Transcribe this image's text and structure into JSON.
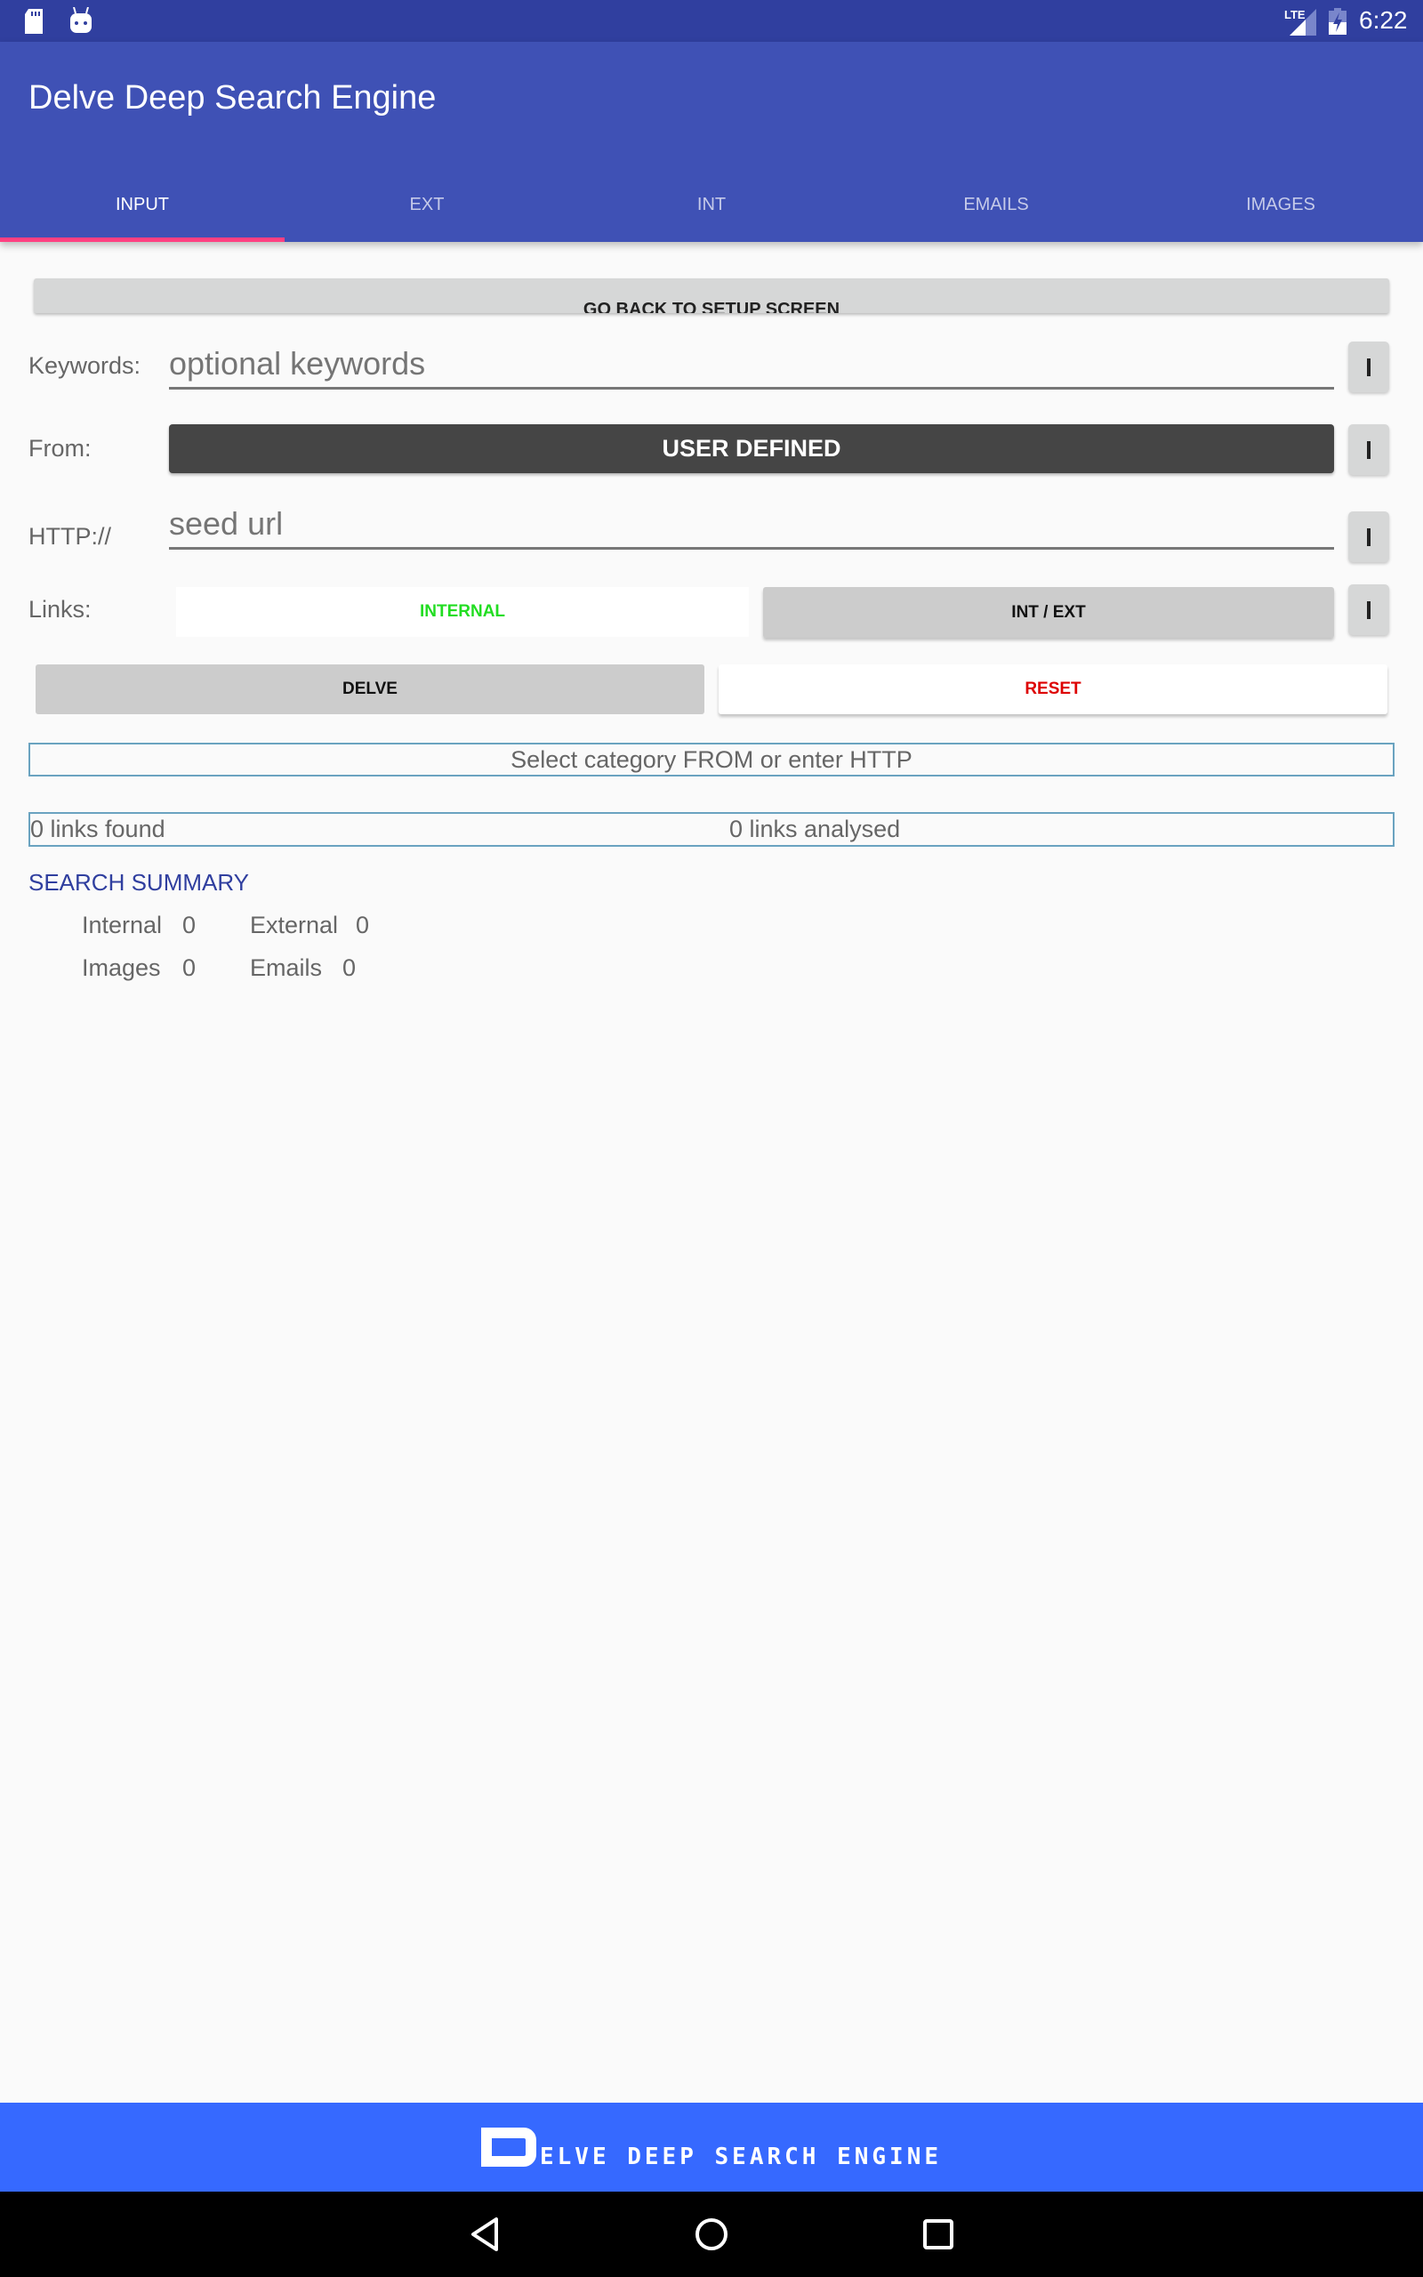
{
  "status_bar": {
    "left_icons": [
      "sd-card-icon",
      "android-debug-icon"
    ],
    "network": "LTE",
    "time": "6:22"
  },
  "app_bar": {
    "title": "Delve Deep Search Engine",
    "tabs": [
      {
        "label": "INPUT",
        "active": true
      },
      {
        "label": "EXT",
        "active": false
      },
      {
        "label": "INT",
        "active": false
      },
      {
        "label": "EMAILS",
        "active": false
      },
      {
        "label": "IMAGES",
        "active": false
      }
    ]
  },
  "form": {
    "go_back_label": "GO BACK TO SETUP SCREEN",
    "keywords": {
      "label": "Keywords:",
      "value": "",
      "placeholder": "optional keywords"
    },
    "from": {
      "label": "From:",
      "value": "USER DEFINED"
    },
    "http": {
      "label": "HTTP://",
      "value": "",
      "placeholder": "seed url"
    },
    "links": {
      "label": "Links:",
      "options": [
        "INTERNAL",
        "INT / EXT"
      ]
    },
    "info_button_label": "I",
    "delve_label": "DELVE",
    "reset_label": "RESET"
  },
  "status": {
    "message": "Select category FROM or enter HTTP",
    "links_found": "0 links found",
    "links_analysed": "0 links analysed"
  },
  "summary": {
    "title": "SEARCH SUMMARY",
    "internal_label": "Internal",
    "internal_value": "0",
    "external_label": "External",
    "external_value": "0",
    "images_label": "Images",
    "images_value": "0",
    "emails_label": "Emails",
    "emails_value": "0"
  },
  "footer": {
    "logo_initial": "D",
    "logo_rest": "ELVE DEEP SEARCH ENGINE"
  },
  "nav_bar": {
    "buttons": [
      "back-icon",
      "home-icon",
      "recents-icon"
    ]
  },
  "colors": {
    "primary": "#3f51b5",
    "primary_dark": "#303f9f",
    "accent": "#ff4081",
    "footer": "#3669ff",
    "internal_text": "#22dd22",
    "reset_text": "#dd0000"
  }
}
